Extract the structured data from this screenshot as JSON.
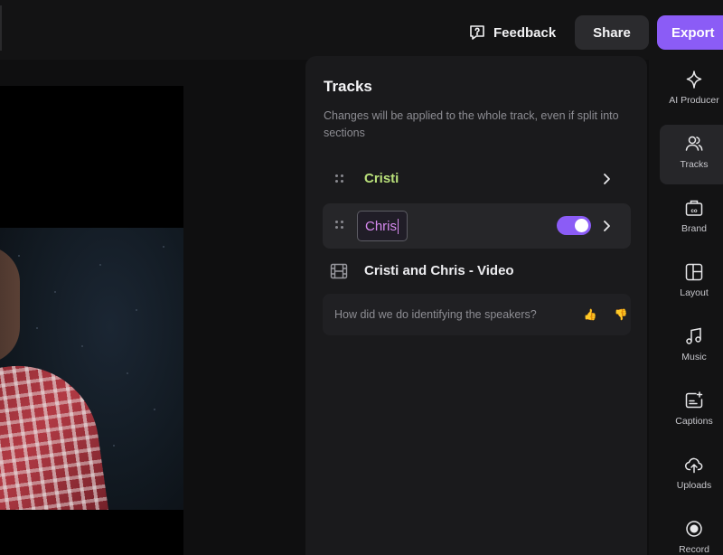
{
  "header": {
    "feedback_label": "Feedback",
    "share_label": "Share",
    "export_label": "Export",
    "accent_color": "#8b5cf6"
  },
  "tracks_panel": {
    "title": "Tracks",
    "subtitle": "Changes will be applied to the whole track, even if split into sections",
    "tracks": [
      {
        "name": "Cristi",
        "color": "#b9e07a"
      },
      {
        "name": "Chris",
        "color": "#d78af0",
        "editing": true,
        "toggle_on": true
      },
      {
        "name": "Cristi and Chris - Video",
        "icon": "film-icon"
      }
    ],
    "feedback_question": "How did we do identifying the speakers?",
    "thumbs_up": "👍",
    "thumbs_down": "👎"
  },
  "rail": {
    "items": [
      {
        "label": "AI Producer",
        "icon": "sparkle-icon"
      },
      {
        "label": "Tracks",
        "icon": "people-icon",
        "active": true
      },
      {
        "label": "Brand",
        "icon": "brand-kit-icon"
      },
      {
        "label": "Layout",
        "icon": "layout-icon"
      },
      {
        "label": "Music",
        "icon": "music-note-icon"
      },
      {
        "label": "Captions",
        "icon": "captions-icon"
      },
      {
        "label": "Uploads",
        "icon": "cloud-upload-icon"
      },
      {
        "label": "Record",
        "icon": "record-icon"
      }
    ]
  }
}
